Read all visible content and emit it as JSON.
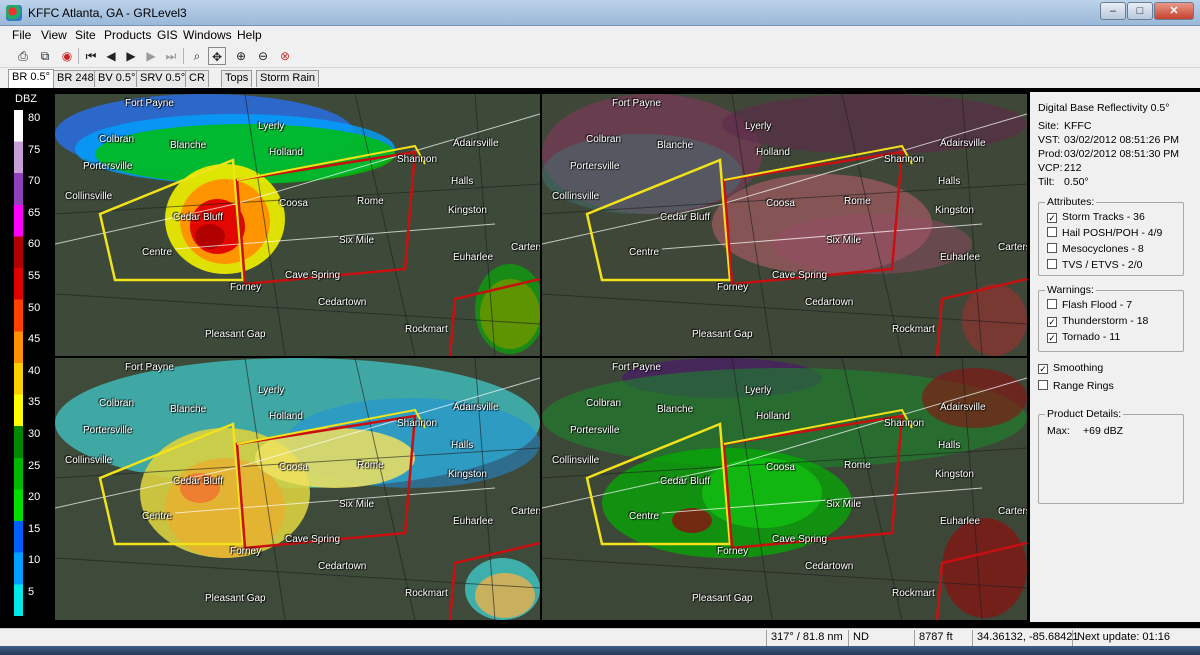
{
  "window": {
    "title": "KFFC Atlanta, GA - GRLevel3",
    "controls": [
      "–",
      "□",
      "✕"
    ]
  },
  "menu": [
    "File",
    "View",
    "Site",
    "Products",
    "GIS",
    "Windows",
    "Help"
  ],
  "toolbar": [
    "print-icon",
    "copy-icon",
    "record-icon",
    "first-frame-icon",
    "previous-frame-icon",
    "play-icon",
    "next-frame-icon",
    "last-frame-icon",
    "zoom-icon",
    "pan-icon",
    "zoom-in-icon",
    "zoom-out-icon",
    "zoom-reset-icon"
  ],
  "tabs": [
    "BR 0.5°",
    "BR 248",
    "BV 0.5°",
    "SRV 0.5°",
    "CR",
    "Tops",
    "Storm Rain"
  ],
  "legend": {
    "title": "DBZ",
    "ticks": [
      "80",
      "75",
      "70",
      "65",
      "60",
      "55",
      "50",
      "45",
      "40",
      "35",
      "30",
      "25",
      "20",
      "15",
      "10",
      "5"
    ],
    "colors": [
      "#ffffff",
      "#c8a0d8",
      "#9040b8",
      "#ff00ff",
      "#b00000",
      "#e00000",
      "#ff4000",
      "#ff9000",
      "#ffd000",
      "#ffff00",
      "#008800",
      "#00b800",
      "#00e000",
      "#0060ff",
      "#00a0ff",
      "#00e8e8"
    ]
  },
  "map_labels": [
    {
      "name": "fort-payne",
      "text": "Fort Payne"
    },
    {
      "name": "colbran",
      "text": "Colbran"
    },
    {
      "name": "blanche",
      "text": "Blanche"
    },
    {
      "name": "lyerly",
      "text": "Lyerly"
    },
    {
      "name": "holland",
      "text": "Holland"
    },
    {
      "name": "adairsville",
      "text": "Adairsville"
    },
    {
      "name": "shannon",
      "text": "Shannon"
    },
    {
      "name": "portersville",
      "text": "Portersville"
    },
    {
      "name": "halls",
      "text": "Halls"
    },
    {
      "name": "collinsville",
      "text": "Collinsville"
    },
    {
      "name": "coosa",
      "text": "Coosa"
    },
    {
      "name": "rome",
      "text": "Rome"
    },
    {
      "name": "kingston",
      "text": "Kingston"
    },
    {
      "name": "cedar-bluff",
      "text": "Cedar Bluff"
    },
    {
      "name": "six-mile",
      "text": "Six Mile"
    },
    {
      "name": "carters",
      "text": "Carters"
    },
    {
      "name": "centre",
      "text": "Centre"
    },
    {
      "name": "euharlee",
      "text": "Euharlee"
    },
    {
      "name": "cave-spring",
      "text": "Cave Spring"
    },
    {
      "name": "forney",
      "text": "Forney"
    },
    {
      "name": "cedartown",
      "text": "Cedartown"
    },
    {
      "name": "rockmart",
      "text": "Rockmart"
    },
    {
      "name": "pleasant-gap",
      "text": "Pleasant Gap"
    }
  ],
  "info": {
    "product": "Digital Base Reflectivity 0.5°",
    "site_label": "Site:",
    "site": "KFFC",
    "vst_label": "VST:",
    "vst": "03/02/2012  08:51:26 PM",
    "prod_label": "Prod:",
    "prod": "03/02/2012  08:51:30 PM",
    "vcp_label": "VCP:",
    "vcp": "212",
    "tilt_label": "Tilt:",
    "tilt": "0.50°"
  },
  "attributes": {
    "title": "Attributes:",
    "items": [
      {
        "label": "Storm Tracks - 36",
        "checked": true
      },
      {
        "label": "Hail POSH/POH - 4/9",
        "checked": false
      },
      {
        "label": "Mesocyclones - 8",
        "checked": false
      },
      {
        "label": "TVS / ETVS - 2/0",
        "checked": false
      }
    ]
  },
  "warnings": {
    "title": "Warnings:",
    "items": [
      {
        "label": "Flash Flood - 7",
        "checked": false
      },
      {
        "label": "Thunderstorm - 18",
        "checked": true
      },
      {
        "label": "Tornado - 11",
        "checked": true
      }
    ]
  },
  "options": {
    "items": [
      {
        "label": "Smoothing",
        "checked": true
      },
      {
        "label": "Range Rings",
        "checked": false
      }
    ]
  },
  "details": {
    "title": "Product Details:",
    "max_label": "Max:",
    "max_value": "+69 dBZ"
  },
  "status": {
    "bearing": "317° / 81.8 nm",
    "value": "ND",
    "height": "8787 ft",
    "coords": "34.36132, -85.68421",
    "next_update": "Next update: 01:16"
  }
}
